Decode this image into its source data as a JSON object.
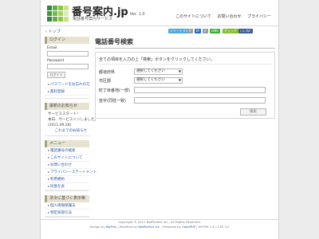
{
  "header": {
    "logo_colors": [
      "#2e8b3a",
      "#5fae3e",
      "#8cc63f",
      "#c7e28f",
      "#3c9a3c",
      "#79b843",
      "#a6d35f",
      "#d9eeb0",
      "#2e8b3a",
      "#5fae3e",
      "#8cc63f",
      "#c7e28f"
    ],
    "title": "番号案内.jp",
    "version": "Ver. 1.0",
    "subtitle": "電話番号案内サービス",
    "nav": [
      "このサイトについて",
      "お問い合わせ",
      "プライバシー"
    ]
  },
  "breadcrumb": "‹ トップ",
  "social": [
    {
      "label": "ツイートする",
      "color": "#4da7de"
    },
    {
      "label": "0",
      "color": "#999999"
    },
    {
      "label": "B!",
      "color": "#1f6fc1"
    },
    {
      "label": "0",
      "color": "#999999"
    },
    {
      "label": "LINE",
      "color": "#3cb034"
    },
    {
      "label": "チェック",
      "color": "#7fbf2a"
    },
    {
      "label": "いいね!",
      "color": "#3b5998"
    }
  ],
  "sidebar": {
    "login": {
      "heading": "ログイン",
      "email_label": "Email",
      "password_label": "Password",
      "button": "ログイン",
      "links": [
        "パスワードをお忘れの方",
        "無料登録"
      ]
    },
    "news": {
      "heading": "最新のお知らせ",
      "lines": [
        "サービススタート！",
        "本日、サービスインしました。",
        "(2011.09.28)"
      ],
      "more": "これまでのお知らせ"
    },
    "menu": {
      "heading": "メニュー",
      "items": [
        "電話番号の検索",
        "このサイトについて",
        "お問い合わせ",
        "プライバシーステートメント",
        "利用規約",
        "同意を表"
      ]
    },
    "legal": {
      "heading": "法令に基づく表示等",
      "items": [
        "個人情報保護法",
        "特定商取引法"
      ]
    }
  },
  "main": {
    "title": "電話番号検索",
    "instruction": "全ての項目を入力の上「検索」ボタンをクリックしてください。",
    "fields": {
      "prefecture": {
        "label": "都道府県",
        "value": "選択してください"
      },
      "city": {
        "label": "市区郡",
        "value": "選択してください"
      },
      "town": {
        "label": "町丁目番地(一部)"
      },
      "name": {
        "label": "苗字(同姓一致)"
      }
    },
    "search_button": "検索"
  },
  "footer": {
    "copyright": "Copyright © 2011 NetPerfect Inc., All Rights Reserved.",
    "design": "Design by",
    "design_name": "WaPlus",
    "modified": "| Modified by",
    "modified_name": "NetPerfect Inc.",
    "powered": "| Powered by",
    "powered_name": "CakePHP",
    "badges": "| XHTML 1.0 | CSS 3.0"
  }
}
